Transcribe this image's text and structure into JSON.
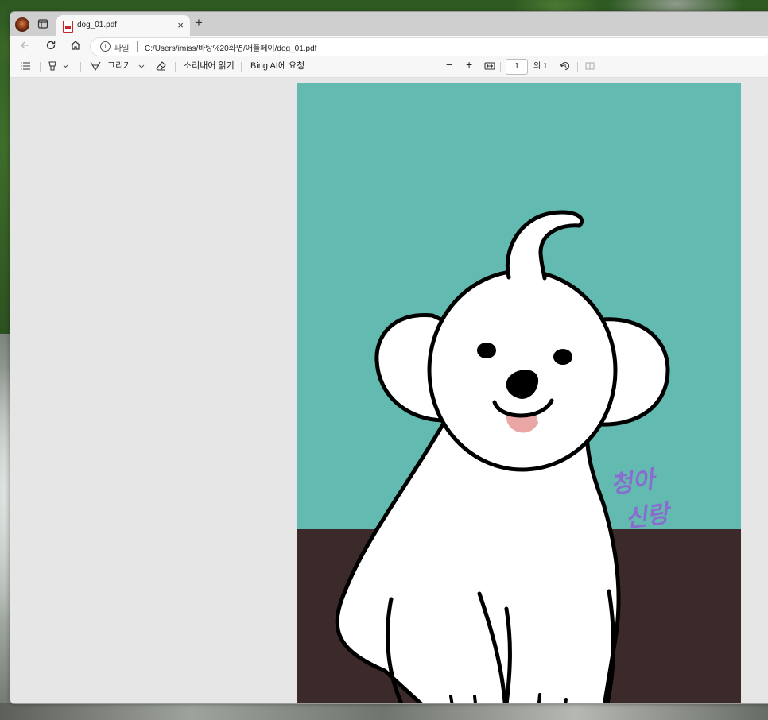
{
  "window": {
    "tab": {
      "title": "dog_01.pdf",
      "close": "×"
    },
    "new_tab": "+"
  },
  "address": {
    "scheme_label": "파일",
    "separator": "|",
    "url": "C:/Users/imiss/바탕%20화면/애플페이/dog_01.pdf"
  },
  "toolbar": {
    "draw_label": "그리기",
    "read_aloud": "소리내어 읽기",
    "ask_bing": "Bing AI에 요청",
    "zoom_out": "−",
    "zoom_in": "+",
    "page_current": "1",
    "page_total": "의 1"
  },
  "document": {
    "signature_line1": "청아",
    "signature_line2": "신랑",
    "colors": {
      "sky": "#63bab1",
      "floor": "#3c2a2b",
      "dog": "#ffffff",
      "outline": "#000000",
      "tongue": "#eaa5a5",
      "signature": "#8a6ccf"
    }
  },
  "icons": [
    "profile-avatar",
    "tab-actions-icon",
    "pdf-file-icon",
    "back-icon",
    "refresh-icon",
    "home-icon",
    "info-icon",
    "contents-icon",
    "highlight-icon",
    "draw-icon",
    "eraser-icon",
    "fit-page-icon",
    "rotate-icon",
    "two-page-icon"
  ]
}
